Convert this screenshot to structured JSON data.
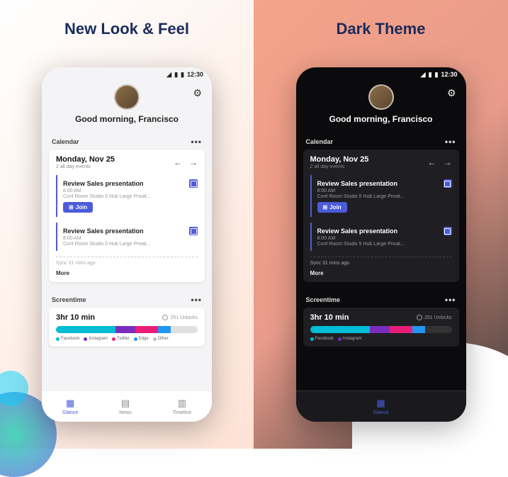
{
  "panels": {
    "left_title": "New Look & Feel",
    "right_title": "Dark Theme"
  },
  "statusbar": {
    "time": "12:30"
  },
  "header": {
    "greeting": "Good morning, Francisco"
  },
  "calendar": {
    "section_label": "Calendar",
    "date": "Monday, Nov 25",
    "allday": "2 all day events",
    "events": [
      {
        "title": "Review Sales presentation",
        "time": "8:00 AM",
        "location": "Conf Room Studio 5 Hub Large Privat...",
        "join_label": "Join"
      },
      {
        "title": "Review Sales presentation",
        "time": "8:00 AM",
        "location": "Conf Room Studio 5 Hub Large Privat..."
      }
    ],
    "sync": "Sync 31 mins ago",
    "more": "More"
  },
  "screentime": {
    "section_label": "Screentime",
    "duration": "3hr 10 min",
    "unlocks": "251 Unlocks",
    "legend": [
      {
        "name": "Facebook",
        "color": "#00bcd4"
      },
      {
        "name": "Instagram",
        "color": "#7b2cbf"
      },
      {
        "name": "Twitter",
        "color": "#e91e77"
      },
      {
        "name": "Edge",
        "color": "#2196f3"
      },
      {
        "name": "Other",
        "color": "#bdbdbd"
      }
    ]
  },
  "nav": {
    "glance": "Glance",
    "news": "News",
    "timeline": "Timeline"
  }
}
